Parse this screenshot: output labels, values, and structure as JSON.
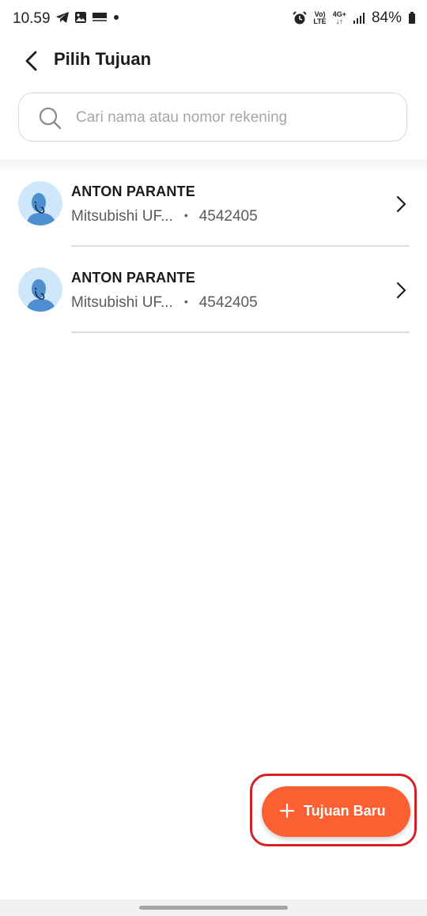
{
  "status_bar": {
    "time": "10.59",
    "battery": "84%",
    "volte_top": "Vo)",
    "volte_bottom": "LTE",
    "network": "4G+",
    "icons": [
      "telegram-icon",
      "gallery-icon",
      "app-notification-icon",
      "dot-icon",
      "alarm-icon",
      "signal-icon",
      "battery-icon"
    ]
  },
  "header": {
    "title": "Pilih Tujuan"
  },
  "search": {
    "placeholder": "Cari nama atau nomor rekening",
    "value": ""
  },
  "recipients": [
    {
      "name": "ANTON PARANTE",
      "bank": "Mitsubishi UF...",
      "account": "4542405"
    },
    {
      "name": "ANTON PARANTE",
      "bank": "Mitsubishi UF...",
      "account": "4542405"
    }
  ],
  "fab": {
    "label": "Tujuan Baru"
  },
  "colors": {
    "accent": "#fb5f32",
    "highlight": "#d42125",
    "avatar_bg": "#cfe7fb",
    "avatar_figure": "#4e8fd1"
  }
}
